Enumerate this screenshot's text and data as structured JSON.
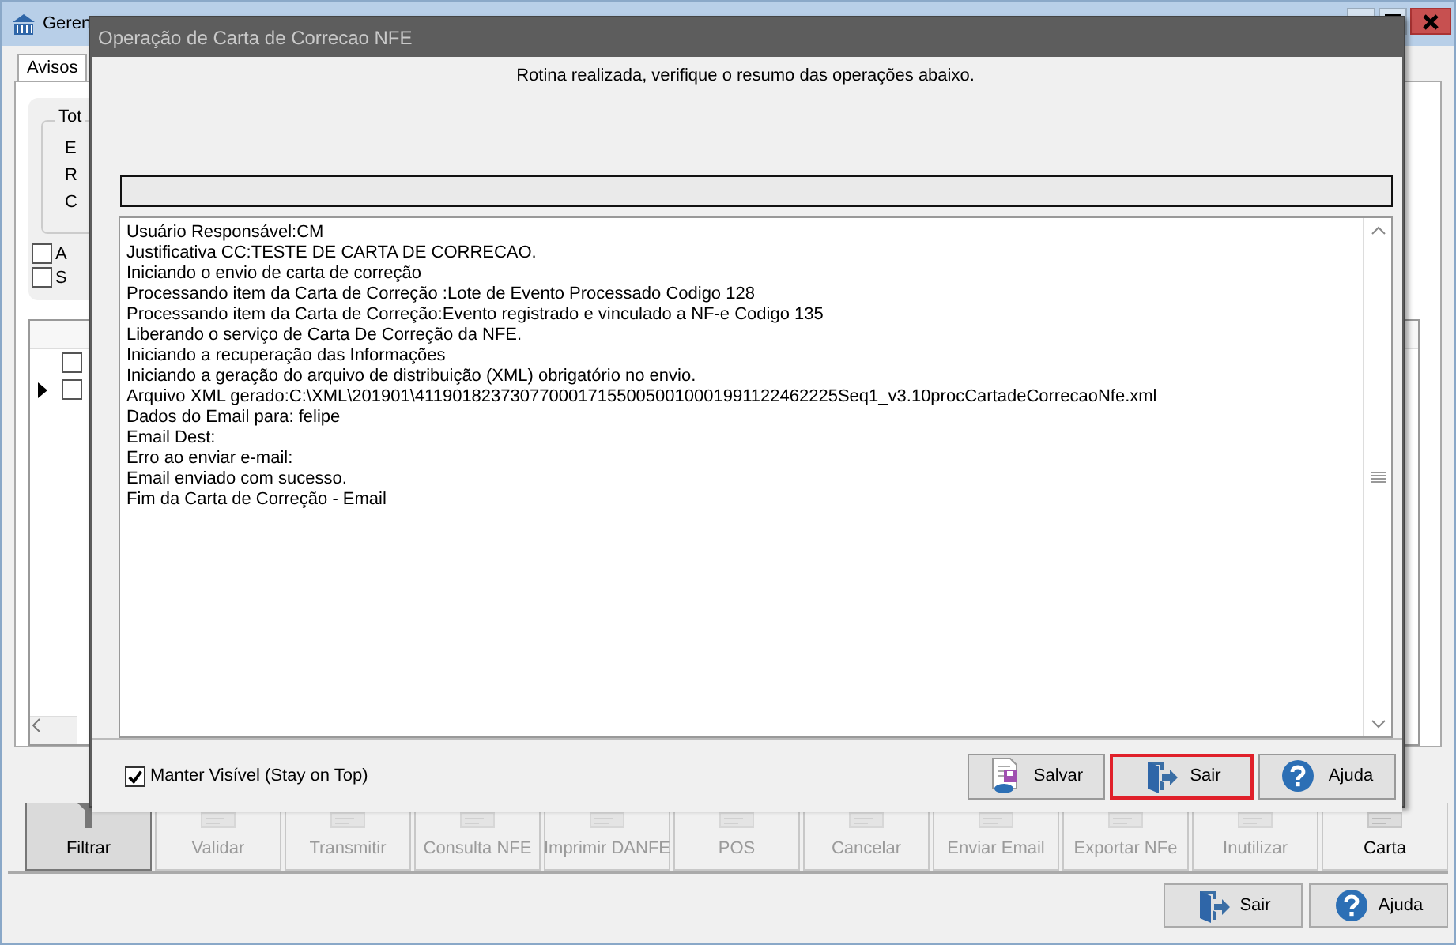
{
  "main_window": {
    "title": "Geren",
    "tabs": [
      {
        "label": "Avisos",
        "selected": true
      }
    ],
    "group": {
      "title": "Tot",
      "labels": [
        "E",
        "R",
        "C"
      ]
    },
    "checkboxes": [
      {
        "label": "A",
        "checked": false
      },
      {
        "label": "S",
        "checked": false
      }
    ],
    "grid": {
      "rows": [
        {
          "current": false,
          "checked": false
        },
        {
          "current": true,
          "checked": false
        }
      ]
    },
    "toolbar": [
      {
        "label": "Filtrar",
        "kind": "filter",
        "disabled": false,
        "selected": true
      },
      {
        "label": "Validar",
        "kind": "doc",
        "disabled": true,
        "selected": false
      },
      {
        "label": "Transmitir",
        "kind": "doc",
        "disabled": true,
        "selected": false
      },
      {
        "label": "Consulta NFE",
        "kind": "doc",
        "disabled": true,
        "selected": false
      },
      {
        "label": "Imprimir DANFE",
        "kind": "doc",
        "disabled": true,
        "selected": false
      },
      {
        "label": "POS",
        "kind": "doc",
        "disabled": true,
        "selected": false
      },
      {
        "label": "Cancelar",
        "kind": "doc",
        "disabled": true,
        "selected": false
      },
      {
        "label": "Enviar Email",
        "kind": "doc",
        "disabled": true,
        "selected": false
      },
      {
        "label": "Exportar NFe",
        "kind": "doc",
        "disabled": true,
        "selected": false
      },
      {
        "label": "Inutilizar",
        "kind": "doc",
        "disabled": true,
        "selected": false
      },
      {
        "label": "Carta",
        "kind": "doc",
        "disabled": false,
        "selected": false
      }
    ],
    "buttons": [
      {
        "label": "Sair",
        "kind": "exit"
      },
      {
        "label": "Ajuda",
        "kind": "help"
      }
    ]
  },
  "dialog": {
    "title": "Operação de Carta de Correcao NFE",
    "message": "Rotina realizada, verifique o resumo das operações abaixo.",
    "progress": {
      "level": 0
    },
    "log": [
      "Usuário Responsável:CM",
      "Justificativa CC:TESTE DE CARTA DE CORRECAO.",
      "Iniciando o envio de carta de correção",
      "Processando item da Carta de Correção :Lote de Evento Processado Codigo 128",
      "Processando item da Carta de Correção:Evento registrado e vinculado a NF-e Codigo 135",
      "Liberando o serviço de Carta De Correção da NFE.",
      "Iniciando a recuperação das Informações",
      "Iniciando a geração do arquivo de distribuição (XML) obrigatório no envio.",
      "Arquivo XML gerado:C:\\XML\\201901\\41190182373077000171550050010001991122462225Seq1_v3.10procCartadeCorrecaoNfe.xml",
      "Dados do Email para: felipe",
      "Email Dest:",
      "Erro ao enviar e-mail:",
      "Email enviado com sucesso.",
      "Fim da Carta de Correção - Email"
    ],
    "stay_on_top": {
      "label": "Manter Visível (Stay on Top)",
      "checked": true
    },
    "buttons": [
      {
        "label": "Salvar",
        "kind": "save",
        "focused": false
      },
      {
        "label": "Sair",
        "kind": "exit",
        "focused": true
      },
      {
        "label": "Ajuda",
        "kind": "help",
        "focused": false
      }
    ]
  }
}
